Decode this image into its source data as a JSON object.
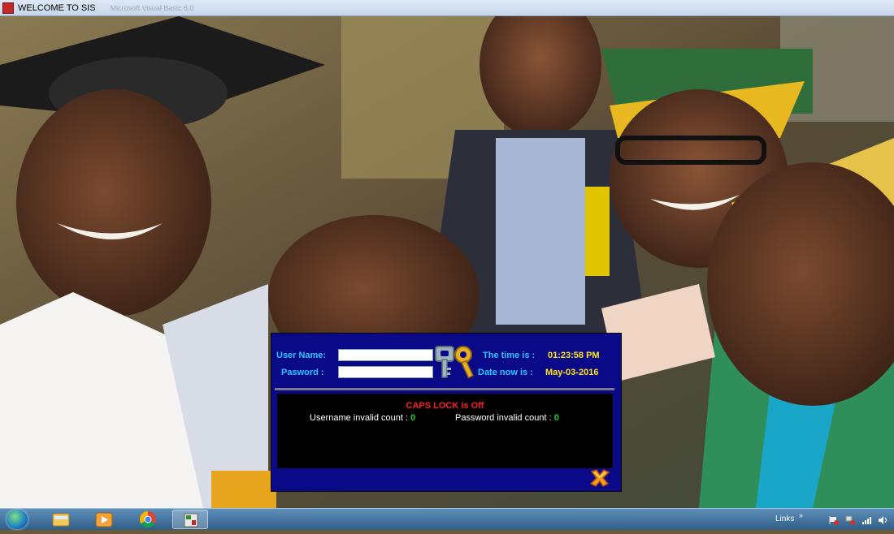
{
  "window": {
    "title": "WELCOME TO SIS",
    "faded_caption": "Microsoft Visual Basic 6.0"
  },
  "login": {
    "username_label": "User Name:",
    "username_value": "",
    "password_label": "Pasword :",
    "password_value": "",
    "time_label": "The time is :",
    "time_value": "01:23:58 PM",
    "date_label": "Date now is :",
    "date_value": "May-03-2016",
    "caps_status": "CAPS LOCK is Off",
    "username_invalid_label": "Username invalid count :",
    "username_invalid_count": "0",
    "password_invalid_label": "Password invalid count  :",
    "password_invalid_count": "0",
    "keys_icon": "keys-icon",
    "close_icon": "close-x-icon"
  },
  "taskbar": {
    "links_label": "Links",
    "links_chevron": "»",
    "pinned": [
      "windows-explorer-icon",
      "media-player-icon",
      "chrome-icon",
      "vb-app-icon"
    ],
    "tray": [
      "flag-icon",
      "network-icon",
      "signal-icon",
      "volume-icon"
    ]
  },
  "colors": {
    "panel_bg": "#0a0a88",
    "label": "#29c6ff",
    "value": "#ffe51a",
    "caps": "#ff1f1f",
    "count": "#1ed21e"
  }
}
